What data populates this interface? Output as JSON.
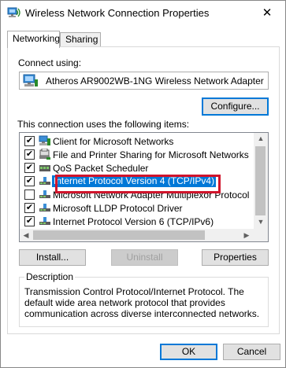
{
  "window": {
    "title": "Wireless Network Connection Properties",
    "close_glyph": "✕"
  },
  "tabs": [
    {
      "label": "Networking",
      "active": true
    },
    {
      "label": "Sharing",
      "active": false
    }
  ],
  "connect_using": {
    "label": "Connect using:",
    "adapter": "Atheros AR9002WB-1NG Wireless Network Adapter",
    "configure_label": "Configure..."
  },
  "items_section": {
    "label": "This connection uses the following items:",
    "items": [
      {
        "label": "Client for Microsoft Networks",
        "checked": true,
        "icon": "network-client-icon"
      },
      {
        "label": "File and Printer Sharing for Microsoft Networks",
        "checked": true,
        "icon": "file-printer-sharing-icon"
      },
      {
        "label": "QoS Packet Scheduler",
        "checked": true,
        "icon": "qos-scheduler-icon"
      },
      {
        "label": "Internet Protocol Version 4 (TCP/IPv4)",
        "checked": true,
        "selected": true,
        "icon": "protocol-icon"
      },
      {
        "label": "Microsoft Network Adapter Multiplexor Protocol",
        "checked": false,
        "icon": "protocol-icon"
      },
      {
        "label": "Microsoft LLDP Protocol Driver",
        "checked": true,
        "icon": "protocol-icon"
      },
      {
        "label": "Internet Protocol Version 6 (TCP/IPv6)",
        "checked": true,
        "icon": "protocol-icon"
      }
    ],
    "highlight_color": "#d0142b",
    "selection_color": "#0078d7"
  },
  "item_buttons": {
    "install": "Install...",
    "uninstall": "Uninstall",
    "properties": "Properties"
  },
  "description": {
    "title": "Description",
    "text": "Transmission Control Protocol/Internet Protocol. The default wide area network protocol that provides communication across diverse interconnected networks."
  },
  "footer": {
    "ok": "OK",
    "cancel": "Cancel"
  }
}
